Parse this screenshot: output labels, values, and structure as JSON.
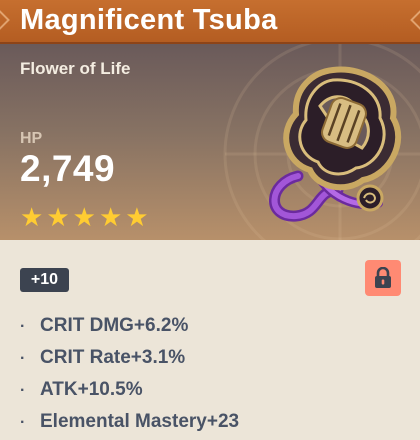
{
  "artifact": {
    "name": "Magnificent Tsuba",
    "slot": "Flower of Life",
    "main_stat": {
      "name": "HP",
      "value": "2,749"
    },
    "rarity": 5,
    "level": "+10",
    "locked": true,
    "substats": [
      "CRIT DMG+6.2%",
      "CRIT Rate+3.1%",
      "ATK+10.5%",
      "Elemental Mastery+23"
    ],
    "bullet": "·"
  },
  "colors": {
    "title_bg": "#b45d22",
    "header_bg": "#877263",
    "body_bg": "#ece5d8",
    "star": "#ffcc32",
    "level_badge": "#3c4350",
    "lock": "#ff8a73",
    "substat_text": "#495366"
  },
  "icons": {
    "rating": "star-icon",
    "lock": "lock-icon",
    "artifact": "tsuba-artifact-icon"
  }
}
